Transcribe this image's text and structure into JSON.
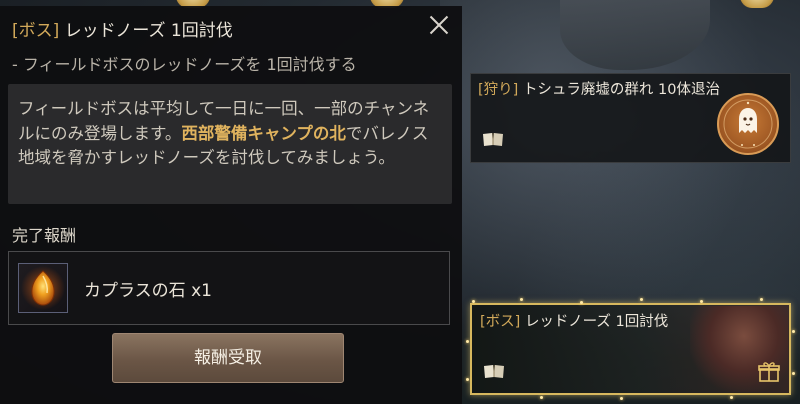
{
  "quest_panel": {
    "title_tag": "[ボス]",
    "title": "レッドノーズ 1回討伐",
    "subtitle": "- フィールドボスのレッドノーズを 1回討伐する",
    "description": {
      "part1": "フィールドボスは平均して一日に一回、一部のチャンネルにのみ登場します。",
      "highlight": "西部警備キャンプの北",
      "part2": "でバレノス地域を脅かすレッドノーズを討伐してみましょう。"
    },
    "reward_label": "完了報酬",
    "reward": {
      "item": "カプラスの石 x1",
      "icon": "caphras-stone-icon"
    },
    "claim_button": "報酬受取",
    "close_icon": "close-icon"
  },
  "tracker": [
    {
      "tag": "[狩り]",
      "title": "トシュラ廃墟の群れ 10体退治",
      "icon": "book-icon",
      "badge_icon": "ghost-badge-icon"
    },
    {
      "tag": "[ボス]",
      "title": "レッドノーズ 1回討伐",
      "icon": "book-icon",
      "gift_icon": "gift-icon"
    }
  ],
  "colors": {
    "accent_gold": "#d2a95a",
    "highlight": "#e0b35e",
    "panel_bg": "#0e0e10",
    "button": "#6b5646",
    "card_border_glow": "#d7b85e"
  }
}
